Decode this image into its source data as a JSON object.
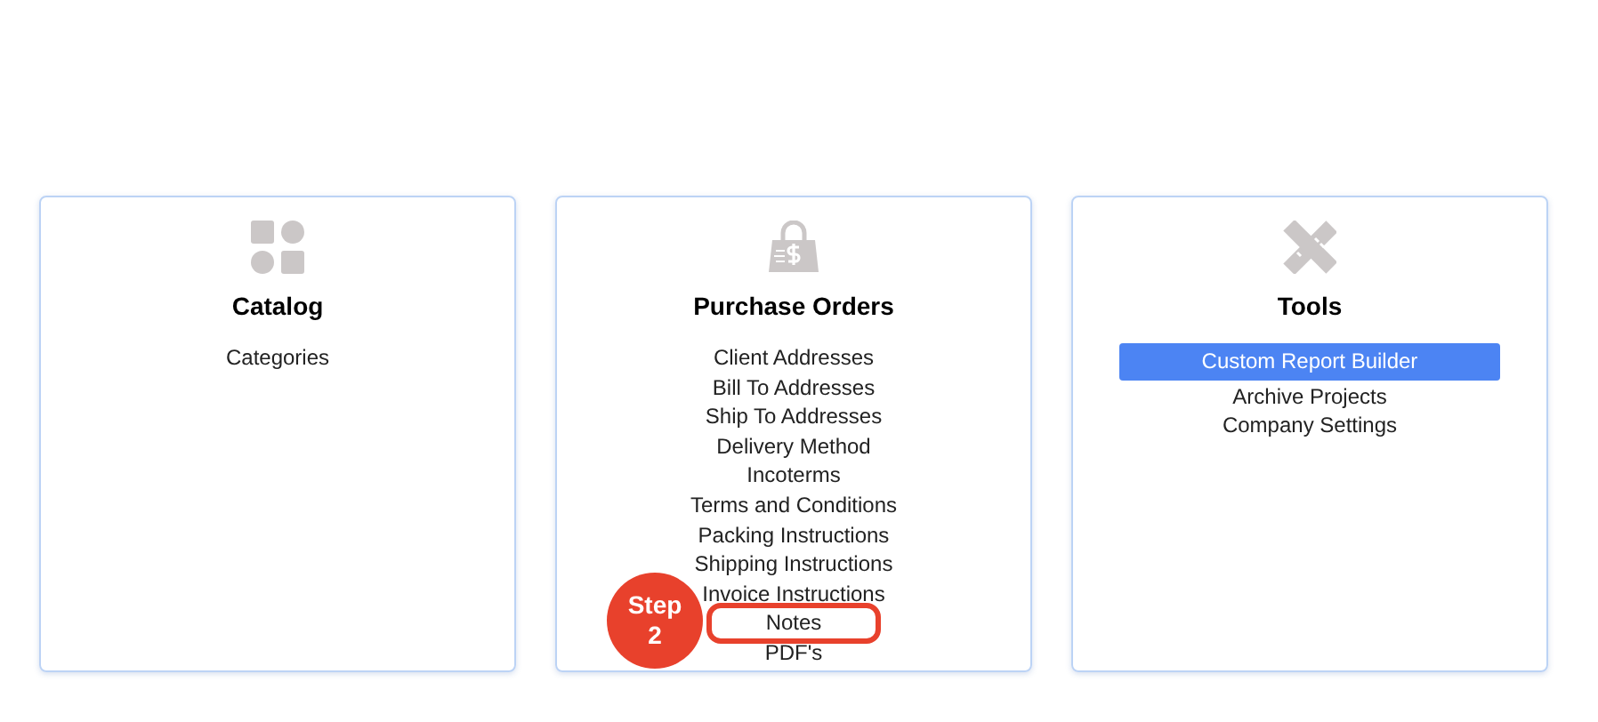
{
  "cards": [
    {
      "title": "Catalog",
      "items": [
        {
          "label": "Categories",
          "selected": false,
          "circled": false
        }
      ]
    },
    {
      "title": "Purchase Orders",
      "items": [
        {
          "label": "Client Addresses",
          "selected": false,
          "circled": false
        },
        {
          "label": "Bill To Addresses",
          "selected": false,
          "circled": false
        },
        {
          "label": "Ship To Addresses",
          "selected": false,
          "circled": false
        },
        {
          "label": "Delivery Method",
          "selected": false,
          "circled": false
        },
        {
          "label": "Incoterms",
          "selected": false,
          "circled": false
        },
        {
          "label": "Terms and Conditions",
          "selected": false,
          "circled": false
        },
        {
          "label": "Packing Instructions",
          "selected": false,
          "circled": false
        },
        {
          "label": "Shipping Instructions",
          "selected": false,
          "circled": false
        },
        {
          "label": "Invoice Instructions",
          "selected": false,
          "circled": false
        },
        {
          "label": "Notes",
          "selected": false,
          "circled": true
        },
        {
          "label": "PDF's",
          "selected": false,
          "circled": false
        }
      ],
      "step_badge": {
        "label": "Step",
        "number": "2"
      }
    },
    {
      "title": "Tools",
      "items": [
        {
          "label": "Custom Report Builder",
          "selected": true,
          "circled": false
        },
        {
          "label": "Archive Projects",
          "selected": false,
          "circled": false
        },
        {
          "label": "Company Settings",
          "selected": false,
          "circled": false
        }
      ]
    }
  ]
}
